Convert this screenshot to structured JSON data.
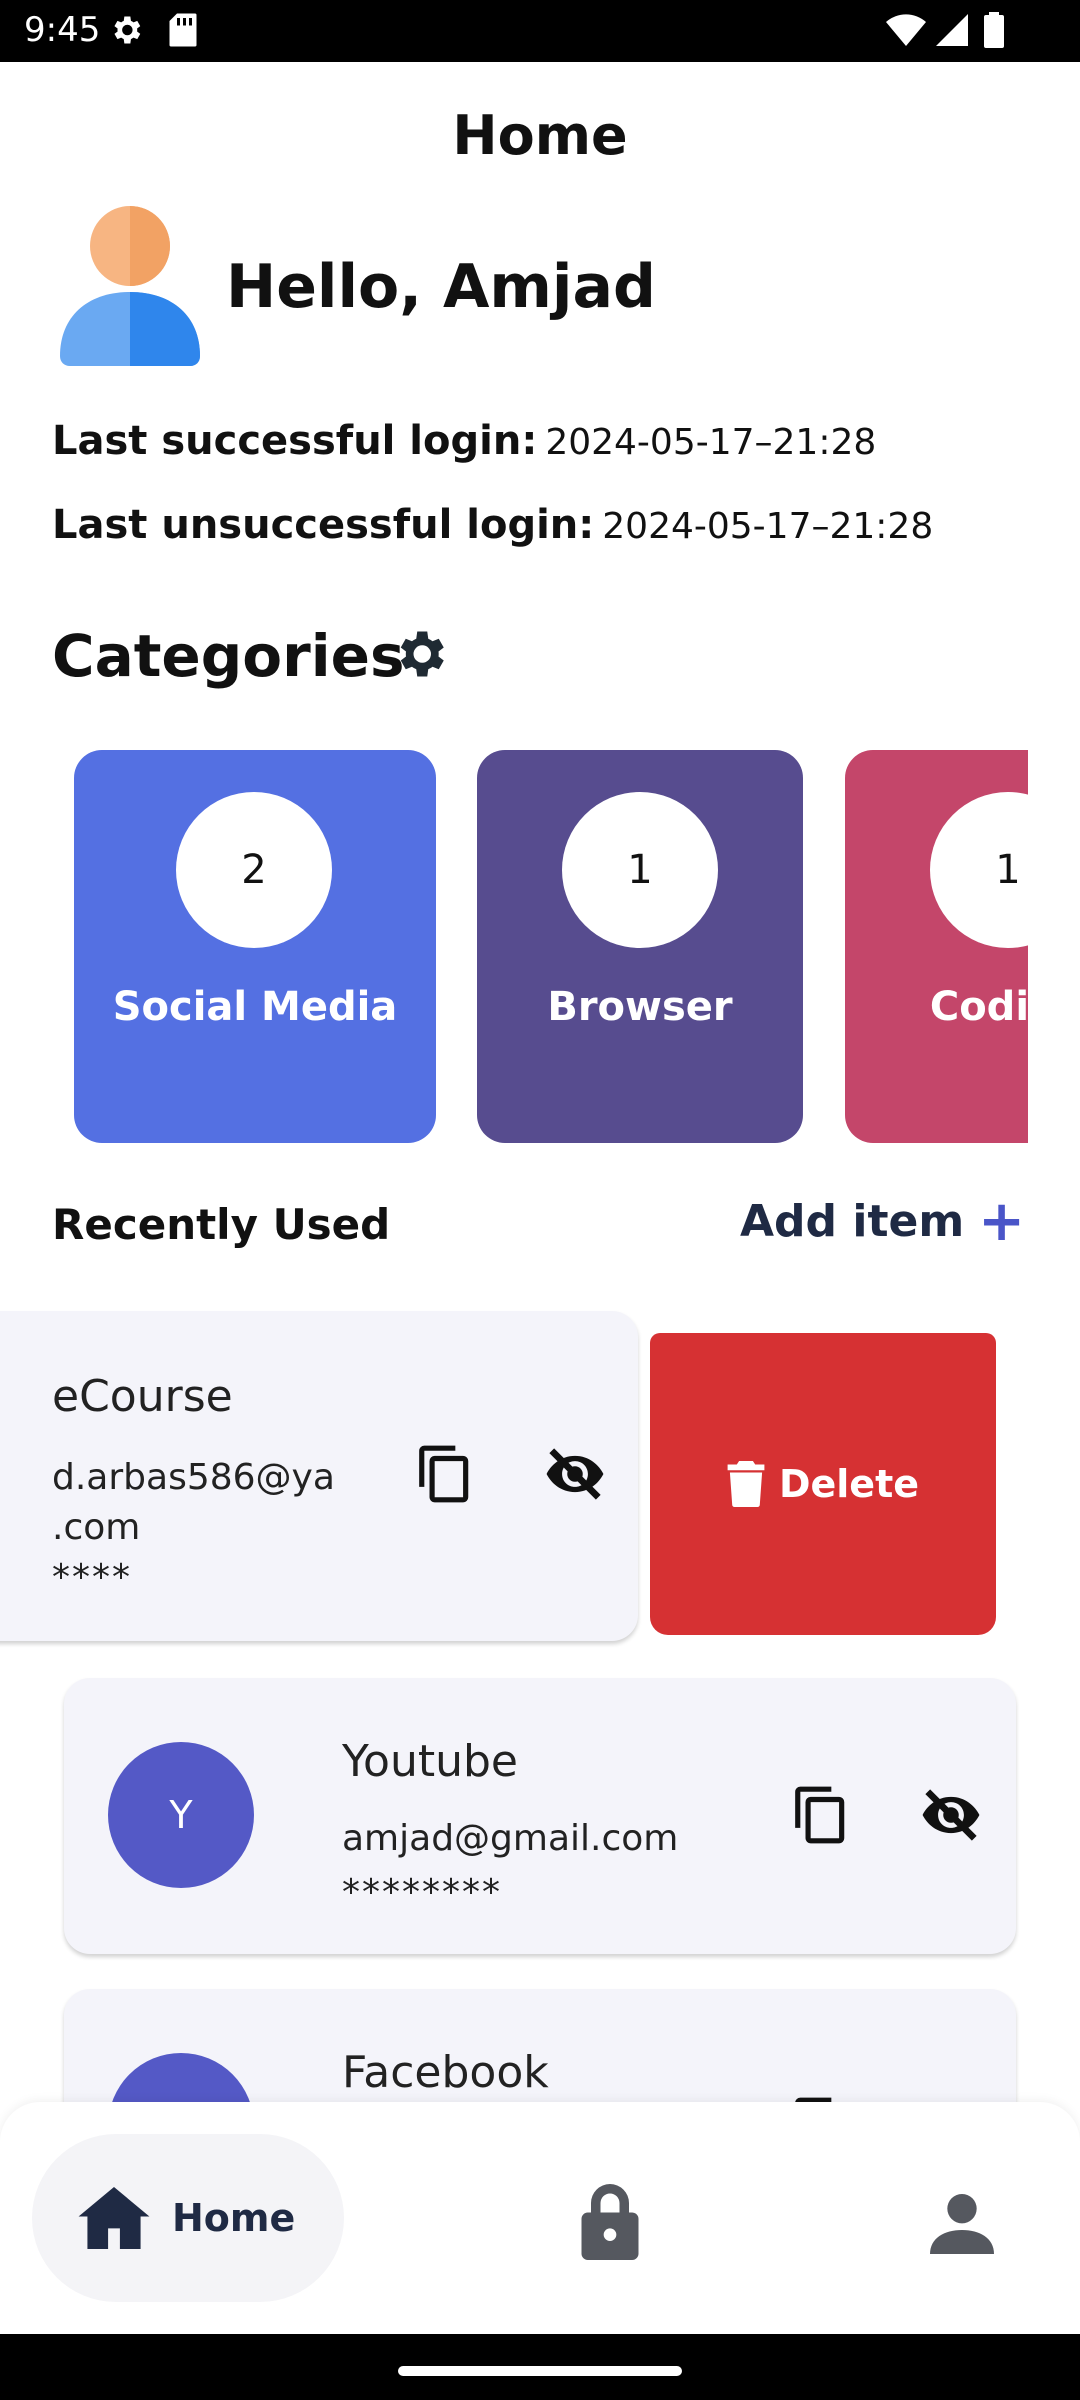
{
  "status_bar": {
    "time": "9:45"
  },
  "header": {
    "title": "Home"
  },
  "greeting": "Hello, Amjad",
  "login": {
    "success_label": "Last successful login:",
    "success_value": "2024-05-17–21:28",
    "fail_label": "Last unsuccessful login:",
    "fail_value": "2024-05-17–21:28"
  },
  "categories": {
    "title": "Categories",
    "items": [
      {
        "count": "2",
        "label": "Social Media",
        "color": "#5470e2"
      },
      {
        "count": "1",
        "label": "Browser",
        "color": "#574c8f"
      },
      {
        "count": "1",
        "label": "Coding",
        "color": "#c4466a"
      }
    ]
  },
  "recent": {
    "title": "Recently Used",
    "add_label": "Add item",
    "items": [
      {
        "name": "eCourse",
        "email": "d.arbas586@ya .com",
        "email_line1": "d.arbas586@ya",
        "email_line2": ".com",
        "password": "****"
      },
      {
        "initial": "Y",
        "name": "Youtube",
        "email": "amjad@gmail.com",
        "password": "********"
      },
      {
        "name": "Facebook"
      }
    ],
    "delete_label": "Delete"
  },
  "nav": {
    "home_label": "Home"
  },
  "colors": {
    "accent": "#5459c6",
    "delete": "#d63133",
    "card_bg": "#f4f4fa"
  }
}
